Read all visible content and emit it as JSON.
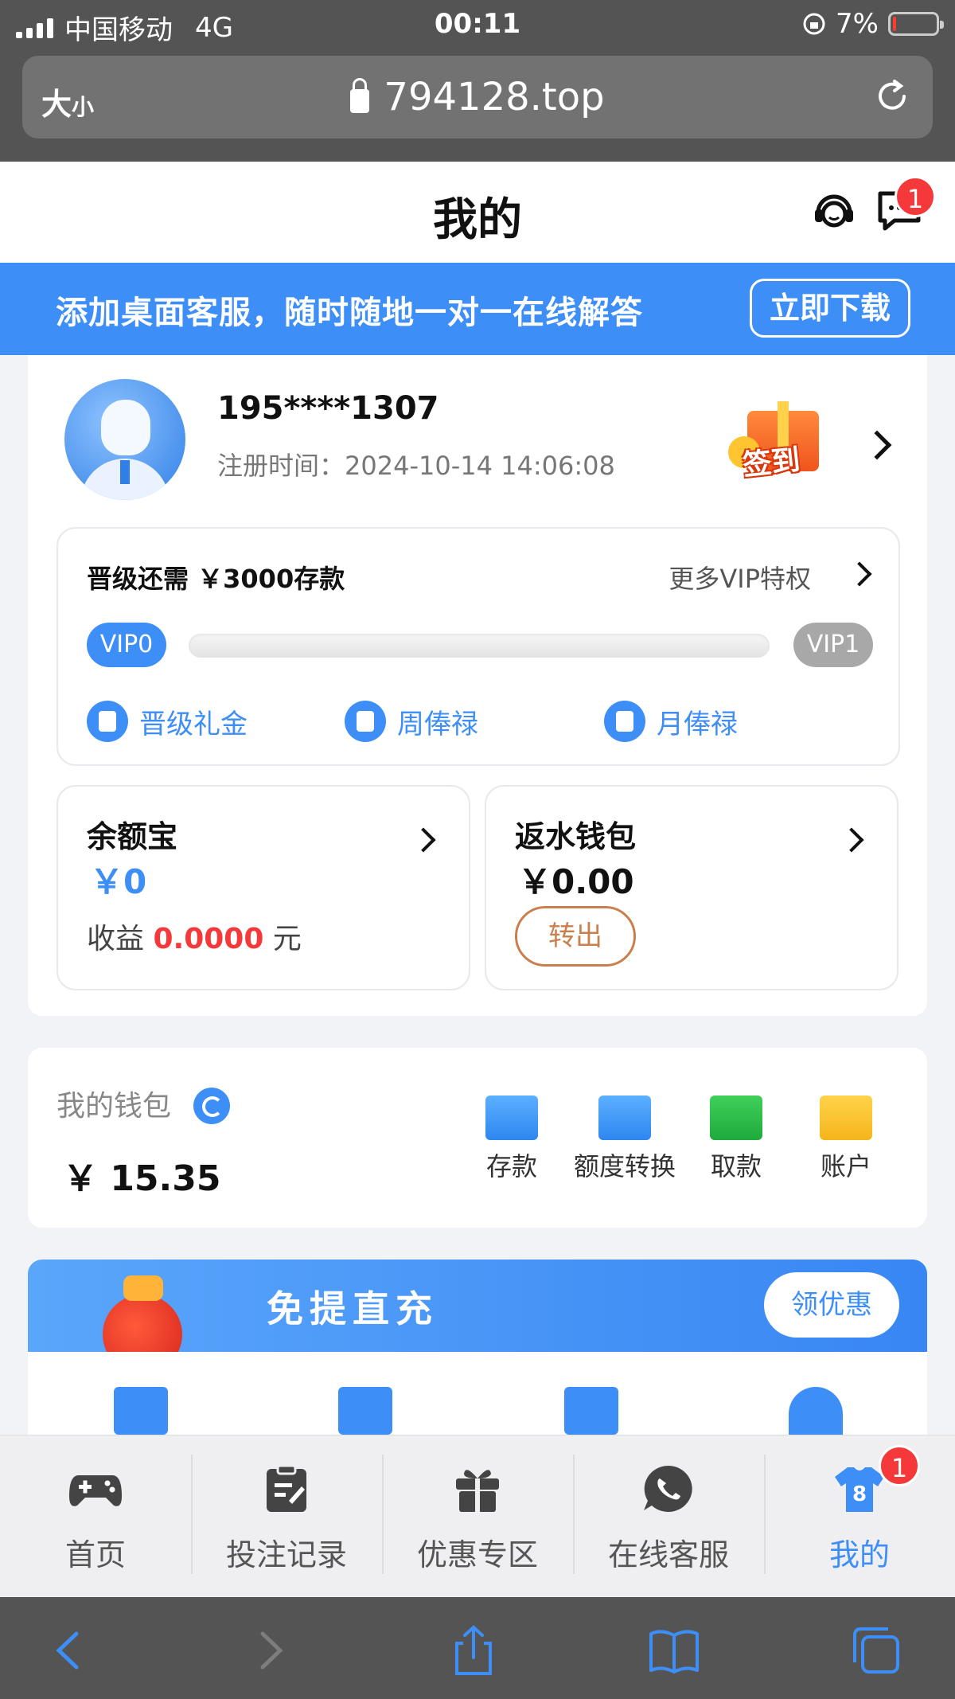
{
  "status_bar": {
    "carrier": "中国移动",
    "network": "4G",
    "time": "00:11",
    "battery": "7%",
    "battery_level_percent": 7
  },
  "browser": {
    "text_size_label_big": "大",
    "text_size_label_small": "小",
    "url": "794128.top"
  },
  "header": {
    "title": "我的",
    "message_badge": "1"
  },
  "banner": {
    "text": "添加桌面客服，随时随地一对一在线解答",
    "button": "立即下载"
  },
  "profile": {
    "username": "195****1307",
    "register_time": "注册时间：2024-10-14 14:06:08",
    "signin_label": "签到"
  },
  "vip": {
    "upgrade_need": "晋级还需 ￥3000存款",
    "more_label": "更多VIP特权",
    "current_level": "VIP0",
    "next_level": "VIP1",
    "progress_percent": 0,
    "perks": [
      "晋级礼金",
      "周俸禄",
      "月俸禄"
    ]
  },
  "yuebao": {
    "title": "余额宝",
    "amount": "￥0",
    "income_label": "收益",
    "income_value": "0.0000",
    "income_unit": "元"
  },
  "rebate": {
    "title": "返水钱包",
    "amount": "￥0.00",
    "button": "转出"
  },
  "wallet": {
    "label": "我的钱包",
    "amount": "￥ 15.35",
    "actions": [
      "存款",
      "额度转换",
      "取款",
      "账户"
    ]
  },
  "recharge": {
    "title": "免提直充",
    "button": "领优惠"
  },
  "tabbar": {
    "tabs": [
      "首页",
      "投注记录",
      "优惠专区",
      "在线客服",
      "我的"
    ],
    "active_index": 4,
    "mine_badge": "1"
  },
  "colors": {
    "accent": "#3d8ef6",
    "danger": "#f5393b",
    "transfer": "#c97f4e"
  }
}
